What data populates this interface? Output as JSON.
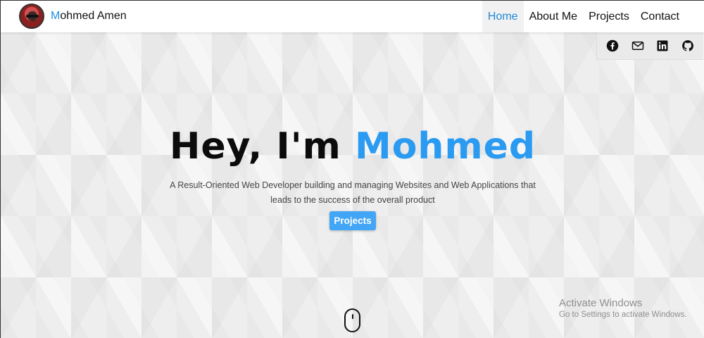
{
  "header": {
    "brand": {
      "first_letter": "M",
      "rest": "ohmed Amen"
    },
    "nav": [
      "Home",
      "About Me",
      "Projects",
      "Contact"
    ],
    "active_nav": "Home"
  },
  "social": [
    "facebook-icon",
    "mail-icon",
    "linkedin-icon",
    "github-icon"
  ],
  "hero": {
    "greeting": "Hey, I'm",
    "name": "Mohmed",
    "description": "A Result-Oriented Web Developer building and managing Websites and Web Applications that leads to the success of the overall product",
    "cta_label": "Projects"
  },
  "watermark": {
    "line1": "Activate Windows",
    "line2": "Go to Settings to activate Windows."
  },
  "colors": {
    "accent": "#2b9bf2",
    "button": "#42a5f5",
    "nav_active": "#1e88d8"
  }
}
